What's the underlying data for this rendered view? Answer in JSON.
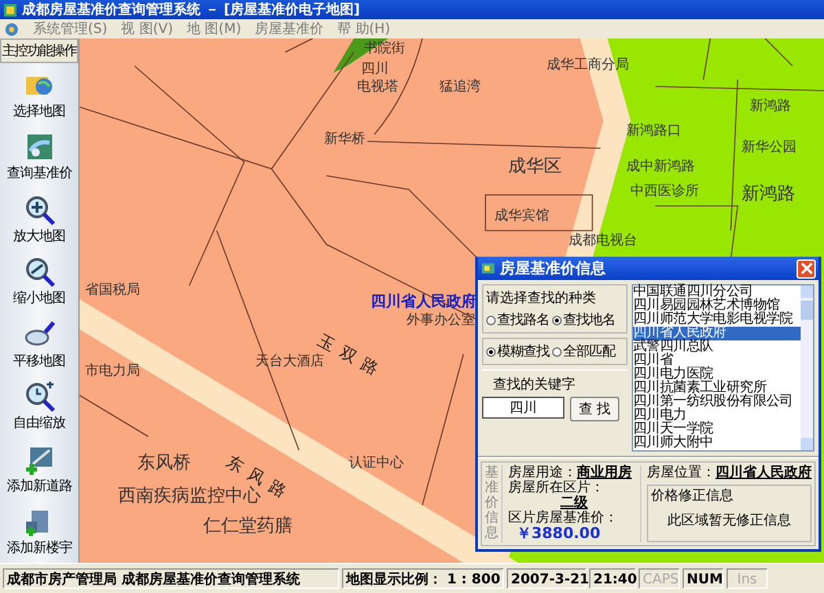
{
  "window": {
    "title": "成都房屋基准价查询管理系统 － [房屋基准价电子地图]"
  },
  "menu": [
    "系统管理(S)",
    "视 图(V)",
    "地 图(M)",
    "房屋基准价",
    "帮 助(H)"
  ],
  "sidebar": {
    "title": "主控功能操作",
    "items": [
      {
        "label": "选择地图",
        "kind": "folder"
      },
      {
        "label": "查询基准价",
        "kind": "map"
      },
      {
        "label": "放大地图",
        "kind": "zoomin"
      },
      {
        "label": "缩小地图",
        "kind": "zoomout"
      },
      {
        "label": "平移地图",
        "kind": "pan"
      },
      {
        "label": "自由缩放",
        "kind": "free"
      },
      {
        "label": "添加新道路",
        "kind": "road"
      },
      {
        "label": "添加新楼宇",
        "kind": "building"
      }
    ]
  },
  "map": {
    "labels": [
      {
        "text": "书院街",
        "kind": "poi"
      },
      {
        "text": "四川",
        "kind": "poi"
      },
      {
        "text": "电视塔",
        "kind": "poi"
      },
      {
        "text": "猛追湾",
        "kind": "poi"
      },
      {
        "text": "成华工商分局",
        "kind": "poi"
      },
      {
        "text": "新华桥",
        "kind": "poi"
      },
      {
        "text": "成华区",
        "kind": "district"
      },
      {
        "text": "成华宾馆",
        "kind": "poi"
      },
      {
        "text": "新鸿路口",
        "kind": "poi"
      },
      {
        "text": "新鸿路",
        "kind": "poi"
      },
      {
        "text": "新华公园",
        "kind": "poi"
      },
      {
        "text": "成中新鸿路",
        "kind": "poi"
      },
      {
        "text": "中西医诊所",
        "kind": "poi"
      },
      {
        "text": "新鸿路",
        "kind": "district"
      },
      {
        "text": "成都电视台",
        "kind": "poi"
      },
      {
        "text": "四川省人民政府",
        "kind": "highlight"
      },
      {
        "text": "外事办公室",
        "kind": "poi"
      },
      {
        "text": "天台大酒店",
        "kind": "poi"
      },
      {
        "text": "省国税局",
        "kind": "poi"
      },
      {
        "text": "市电力局",
        "kind": "poi"
      },
      {
        "text": "东风桥",
        "kind": "district"
      },
      {
        "text": "西南疾病监控中心",
        "kind": "district"
      },
      {
        "text": "仁仁堂药膳",
        "kind": "district"
      },
      {
        "text": "认证中心",
        "kind": "poi"
      },
      {
        "text": "东风路",
        "kind": "road"
      },
      {
        "text": "玉双路",
        "kind": "road"
      }
    ]
  },
  "dialog": {
    "title": "房屋基准价信息",
    "search_type": {
      "label": "请选择查找的种类",
      "options": [
        {
          "label": "查找路名",
          "selected": false
        },
        {
          "label": "查找地名",
          "selected": true
        }
      ]
    },
    "match": {
      "options": [
        {
          "label": "模糊查找",
          "selected": true
        },
        {
          "label": "全部匹配",
          "selected": false
        }
      ]
    },
    "keyword": {
      "label": "查找的关键字",
      "value": "四川"
    },
    "search_button": "查 找",
    "results": [
      {
        "label": "中国联通四川分公司",
        "selected": false
      },
      {
        "label": "四川易园园林艺术博物馆",
        "selected": false
      },
      {
        "label": "四川师范大学电影电视学院",
        "selected": false
      },
      {
        "label": "四川省人民政府",
        "selected": true
      },
      {
        "label": "武警四川总队",
        "selected": false
      },
      {
        "label": "四川省",
        "selected": false
      },
      {
        "label": "四川电力医院",
        "selected": false
      },
      {
        "label": "四川抗菌素工业研究所",
        "selected": false
      },
      {
        "label": "四川第一纺织股份有限公司",
        "selected": false
      },
      {
        "label": "四川电力",
        "selected": false
      },
      {
        "label": "四川天一学院",
        "selected": false
      },
      {
        "label": "四川师大附中",
        "selected": false
      }
    ],
    "info": {
      "side_title": "基准价信息",
      "usage_label": "房屋用途：",
      "usage": "商业用房",
      "zone_label": "房屋所在区片：",
      "zone": "二级",
      "price_label": "区片房屋基准价：",
      "price": "￥3880.00",
      "location_label": "房屋位置：",
      "location": "四川省人民政府",
      "correction_title": "价格修正信息",
      "correction": "此区域暂无修正信息"
    }
  },
  "status_bar": {
    "org": "成都市房产管理局 成都房屋基准价查询管理系统",
    "scale": "地图显示比例： 1 : 800",
    "date": "2007-3-21",
    "time": "21:40",
    "keys": [
      {
        "label": "CAPS",
        "on": false
      },
      {
        "label": "NUM",
        "on": true
      },
      {
        "label": "Ins",
        "on": false
      }
    ]
  }
}
